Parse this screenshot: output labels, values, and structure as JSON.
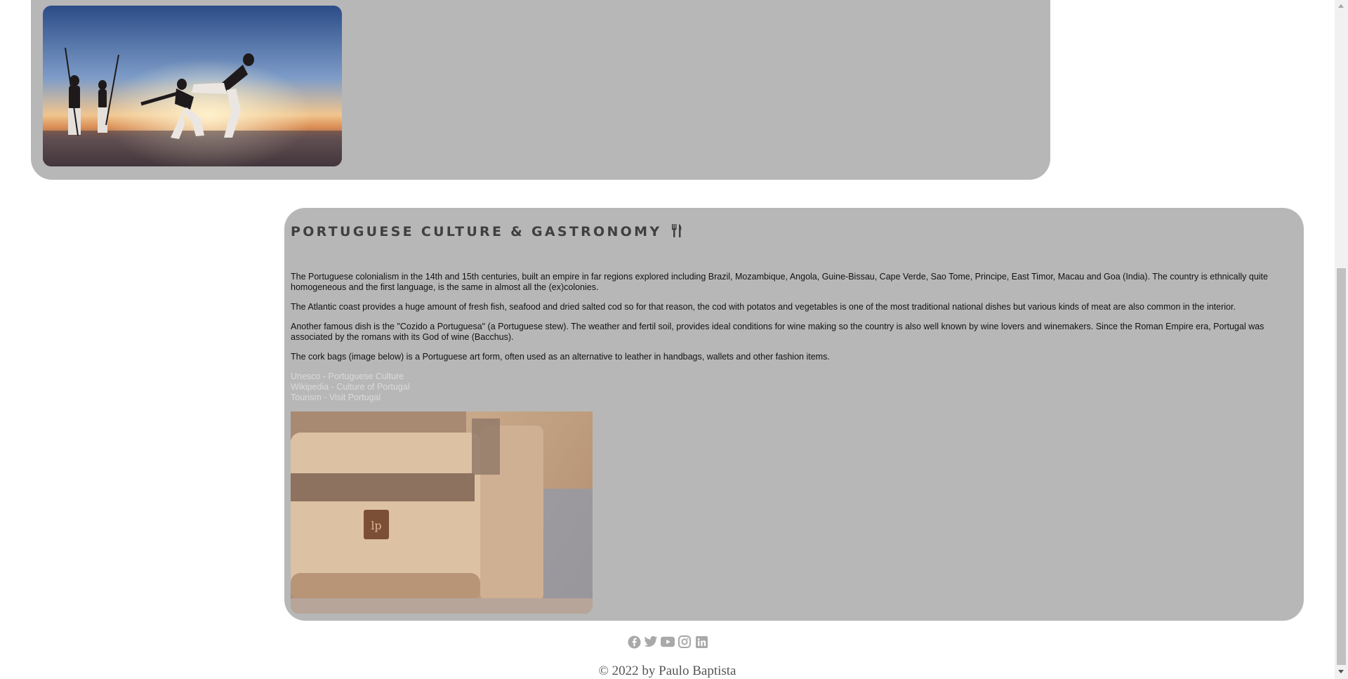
{
  "culture": {
    "title": "PORTUGUESE CULTURE & GASTRONOMY",
    "title_icon": "fork-knife-icon",
    "paragraphs": [
      "The Portuguese colonialism in the 14th and 15th centuries, built an empire in far regions explored including Brazil, Mozambique, Angola, Guine-Bissau, Cape Verde, Sao Tome, Principe, East Timor, Macau and Goa (India). The country is ethnically quite homogeneous and the first language, is the same in almost all the (ex)colonies.",
      "The Atlantic coast provides a huge amount of fresh fish, seafood and dried salted cod so for that reason, the cod with potatos and vegetables is one of the most traditional national dishes but various kinds of meat are also common in the interior.",
      "Another famous dish is the \"Cozido a Portuguesa\" (a Portuguese stew). The weather and fertil soil, provides ideal conditions for wine making so the country is also well known by wine lovers and winemakers. Since the Roman Empire era, Portugal was associated by the romans with its God of wine (Bacchus).",
      "The cork bags (image below) is a Portuguese art form, often used as an alternative to leather in handbags, wallets and other fashion items."
    ],
    "links": [
      "Unesco - Portuguese Culture",
      "Wikipedia - Culture of Portugal",
      "Tourism - Visit Portugal"
    ]
  },
  "footer": {
    "social_icons": [
      "facebook-icon",
      "twitter-icon",
      "youtube-icon",
      "instagram-icon",
      "linkedin-icon"
    ],
    "copyright": "© 2022 by Paulo Baptista"
  },
  "colors": {
    "card_bg": "#b7b7b7",
    "link": "#dadada",
    "title": "#3f3f3f",
    "icon": "#a9a9a9"
  }
}
